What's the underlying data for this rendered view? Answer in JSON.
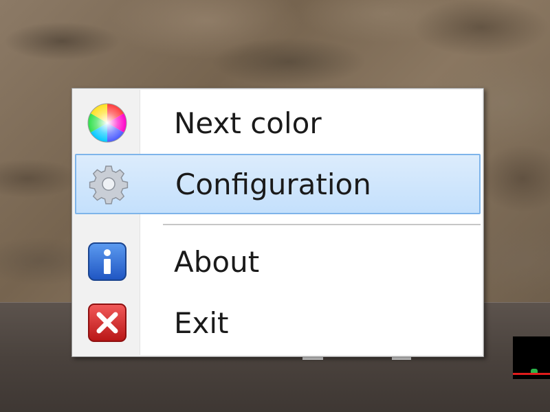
{
  "context_menu": {
    "items": [
      {
        "label": "Next color",
        "icon": "color-wheel-icon",
        "highlighted": false
      },
      {
        "label": "Configuration",
        "icon": "gear-icon",
        "highlighted": true
      },
      {
        "label": "About",
        "icon": "info-icon",
        "highlighted": false
      },
      {
        "label": "Exit",
        "icon": "close-icon",
        "highlighted": false
      }
    ]
  },
  "colors": {
    "highlight_fill": "#c4e0fc",
    "highlight_border": "#7eb4ea",
    "info_blue": "#2f6fd6",
    "exit_red": "#d42a2a"
  }
}
